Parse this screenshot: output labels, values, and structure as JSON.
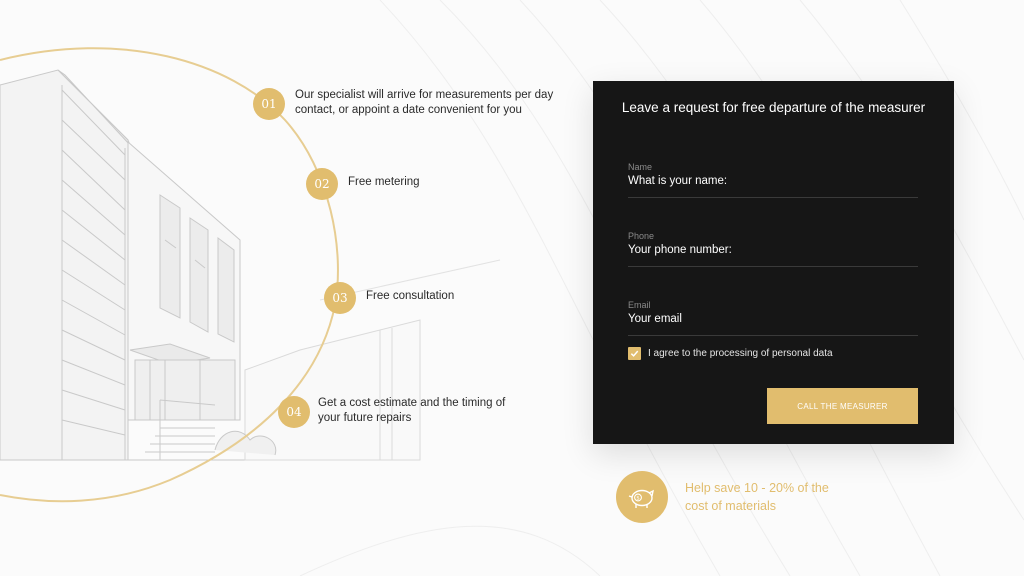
{
  "steps": [
    {
      "number": "01",
      "text": "Our specialist will arrive for measurements per day contact, or appoint a date convenient for you"
    },
    {
      "number": "02",
      "text": "Free metering"
    },
    {
      "number": "03",
      "text": "Free consultation"
    },
    {
      "number": "04",
      "text": "Get a cost estimate and the timing of your future repairs"
    }
  ],
  "form": {
    "title": "Leave a request for free departure of the measurer",
    "fields": [
      {
        "label": "Name",
        "placeholder": "What is your name:"
      },
      {
        "label": "Phone",
        "placeholder": "Your phone number:"
      },
      {
        "label": "Email",
        "placeholder": "Your email"
      }
    ],
    "consent": {
      "label": "I agree to the processing of personal data",
      "checked": true
    },
    "submit_label": "CALL THE MEASURER"
  },
  "savings": {
    "text": "Help save 10 - 20% of the cost of materials",
    "icon": "piggy-bank-icon"
  },
  "colors": {
    "accent": "#e1bd6e",
    "panel": "#161616",
    "background": "#fbfbfb"
  }
}
